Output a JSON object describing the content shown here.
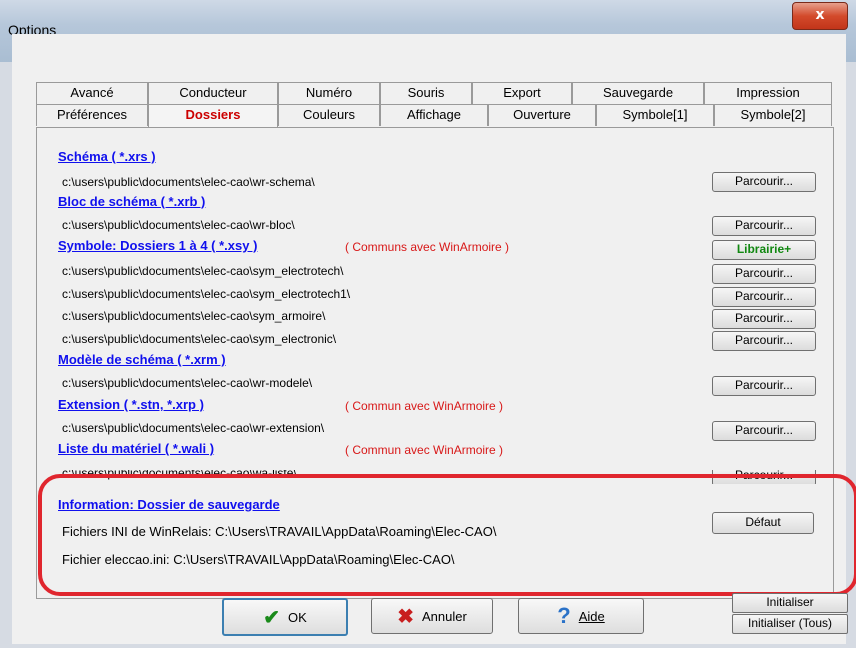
{
  "window": {
    "title": "Options",
    "close_label": "x"
  },
  "tabs_row1": [
    "Avancé",
    "Conducteur",
    "Numéro",
    "Souris",
    "Export",
    "Sauvegarde",
    "Impression"
  ],
  "tabs_row2": [
    "Préférences",
    "Dossiers",
    "Couleurs",
    "Affichage",
    "Ouverture",
    "Symbole[1]",
    "Symbole[2]"
  ],
  "active_tab": "Dossiers",
  "sections": {
    "schema": {
      "header": "Schéma ( *.xrs )",
      "path": "c:\\users\\public\\documents\\elec-cao\\wr-schema\\",
      "button": "Parcourir..."
    },
    "bloc": {
      "header": "Bloc de schéma ( *.xrb )",
      "path": "c:\\users\\public\\documents\\elec-cao\\wr-bloc\\",
      "button": "Parcourir..."
    },
    "symbole": {
      "header": "Symbole: Dossiers 1 à 4 ( *.xsy )",
      "note": "( Communs avec WinArmoire )",
      "button": "Librairie+",
      "paths": [
        "c:\\users\\public\\documents\\elec-cao\\sym_electrotech\\",
        "c:\\users\\public\\documents\\elec-cao\\sym_electrotech1\\",
        "c:\\users\\public\\documents\\elec-cao\\sym_armoire\\",
        "c:\\users\\public\\documents\\elec-cao\\sym_electronic\\"
      ],
      "path_button": "Parcourir..."
    },
    "modele": {
      "header": "Modèle de schéma ( *.xrm )",
      "path": "c:\\users\\public\\documents\\elec-cao\\wr-modele\\",
      "button": "Parcourir..."
    },
    "extension": {
      "header": "Extension ( *.stn, *.xrp )",
      "note": "( Commun avec WinArmoire )",
      "path": "c:\\users\\public\\documents\\elec-cao\\wr-extension\\",
      "button": "Parcourir..."
    },
    "liste": {
      "header": "Liste du matériel ( *.wali )",
      "note": "( Commun avec WinArmoire )",
      "path": "c:\\users\\public\\documents\\elec-cao\\wa-liste\\",
      "button": "Parcourir..."
    }
  },
  "info": {
    "header": "Information: Dossier de sauvegarde",
    "ini_line": "Fichiers INI de WinRelais: C:\\Users\\TRAVAIL\\AppData\\Roaming\\Elec-CAO\\",
    "eleccao_line": "Fichier eleccao.ini: C:\\Users\\TRAVAIL\\AppData\\Roaming\\Elec-CAO\\",
    "default_button": "Défaut"
  },
  "footer": {
    "ok": "OK",
    "cancel": "Annuler",
    "help": "Aide",
    "init": "Initialiser",
    "init_all": "Initialiser (Tous)"
  },
  "colors": {
    "link": "#1010ee",
    "note": "#d81818",
    "active_tab": "#cc0000",
    "highlight_ring": "#e0262e"
  }
}
